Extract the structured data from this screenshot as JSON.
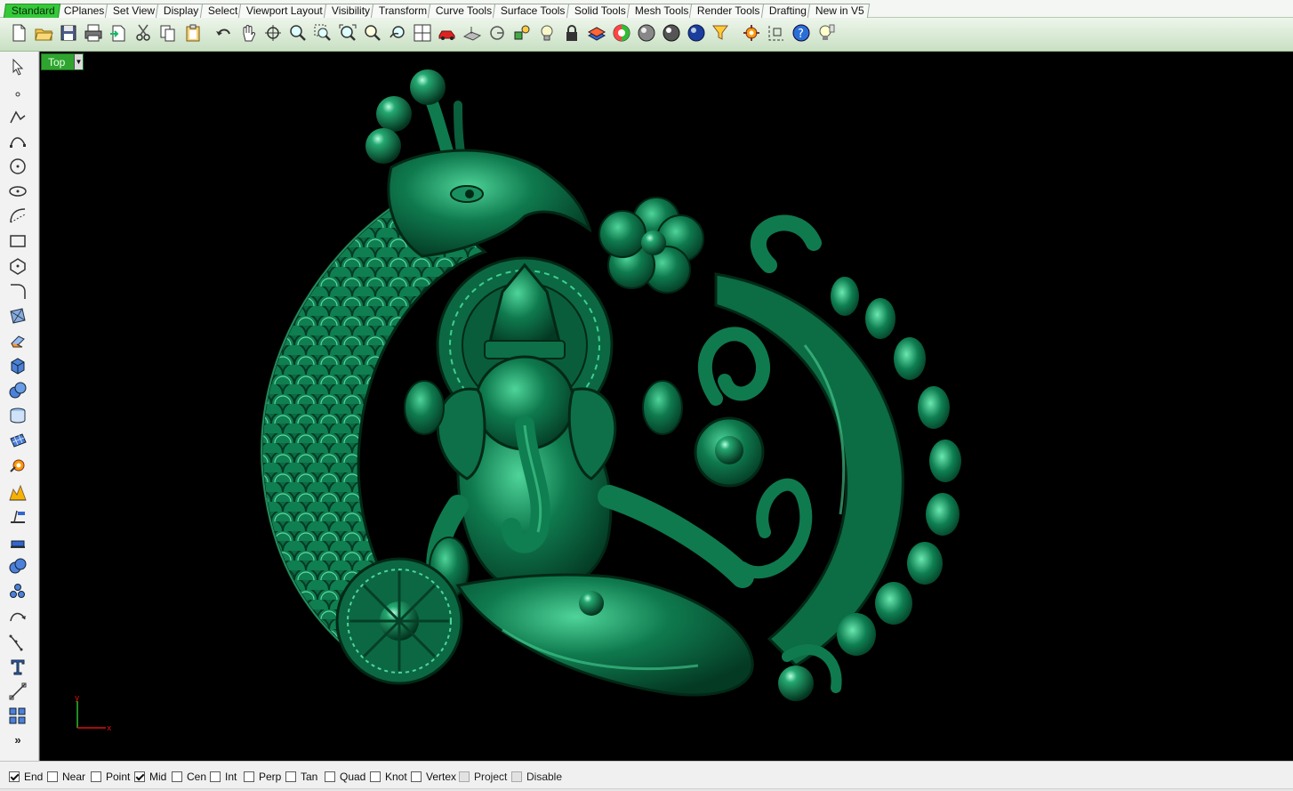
{
  "tabs": [
    {
      "label": "Standard",
      "active": true
    },
    {
      "label": "CPlanes"
    },
    {
      "label": "Set View"
    },
    {
      "label": "Display"
    },
    {
      "label": "Select"
    },
    {
      "label": "Viewport Layout"
    },
    {
      "label": "Visibility"
    },
    {
      "label": "Transform"
    },
    {
      "label": "Curve Tools"
    },
    {
      "label": "Surface Tools"
    },
    {
      "label": "Solid Tools"
    },
    {
      "label": "Mesh Tools"
    },
    {
      "label": "Render Tools"
    },
    {
      "label": "Drafting"
    },
    {
      "label": "New in V5"
    }
  ],
  "toolbar_icons": [
    "new-document-icon",
    "open-folder-icon",
    "save-disk-icon",
    "print-icon",
    "import-icon",
    "cut-scissors-icon",
    "copy-icon",
    "paste-clipboard-icon",
    "undo-icon",
    "pan-hand-icon",
    "rotate-view-icon",
    "zoom-dynamic-icon",
    "zoom-window-icon",
    "zoom-extents-icon",
    "zoom-selected-icon",
    "undo-view-icon",
    "four-viewports-icon",
    "car-icon",
    "cplane-icon",
    "grid-snap-icon",
    "object-properties-icon",
    "light-bulb-icon",
    "lock-icon",
    "layers-icon",
    "color-wheel-icon",
    "shaded-sphere-icon",
    "rendered-sphere-icon",
    "render-preview-icon",
    "select-filter-icon",
    "settings-gear-icon",
    "dimension-icon",
    "help-icon",
    "tips-lightbulb-icon"
  ],
  "left_icons": [
    "select-arrow-icon",
    "point-icon",
    "polyline-icon",
    "curve-control-points-icon",
    "circle-icon",
    "ellipse-icon",
    "arc-icon",
    "rectangle-icon",
    "polygon-icon",
    "fillet-curve-icon",
    "surface-corners-icon",
    "extrude-surface-icon",
    "solid-box-icon",
    "solid-spheres-icon",
    "cylinder-icon",
    "mesh-plane-icon",
    "transform-gear-icon",
    "explode-icon",
    "trim-icon",
    "split-icon",
    "boolean-union-icon",
    "point-cloud-icon",
    "rebuild-curve-icon",
    "curve-point-edit-icon",
    "text-icon",
    "dimension-line-icon",
    "grid-array-icon"
  ],
  "left_more": "»",
  "viewport": {
    "name": "Top",
    "dropdown_glyph": "▼",
    "axis_y": "y",
    "axis_x": "x"
  },
  "osnaps": [
    {
      "label": "End",
      "checked": true
    },
    {
      "label": "Near",
      "checked": false
    },
    {
      "label": "Point",
      "checked": false
    },
    {
      "label": "Mid",
      "checked": true
    },
    {
      "label": "Cen",
      "checked": false
    },
    {
      "label": "Int",
      "checked": false
    },
    {
      "label": "Perp",
      "checked": false
    },
    {
      "label": "Tan",
      "checked": false
    },
    {
      "label": "Quad",
      "checked": false
    },
    {
      "label": "Knot",
      "checked": false
    },
    {
      "label": "Vertex",
      "checked": false
    },
    {
      "label": "Project",
      "checked": false,
      "disabled": true
    },
    {
      "label": "Disable",
      "checked": false,
      "disabled": true
    }
  ],
  "colors": {
    "active_tab": "#35c93a",
    "viewport_bg": "#000000",
    "model_green": "#0f7a4e",
    "viewport_label": "#2fa52f"
  }
}
